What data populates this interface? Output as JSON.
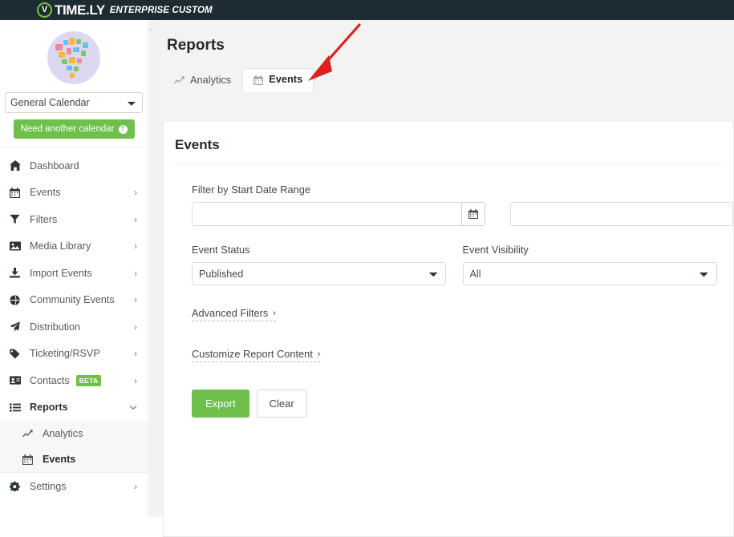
{
  "brand": {
    "mark": "timely-v-logo",
    "name": "TIME.LY",
    "edition": "ENTERPRISE CUSTOM",
    "accent_color": "#7ac143",
    "bar_color": "#1d2b33"
  },
  "sidebar": {
    "calendar_select": {
      "value": "General Calendar",
      "options": [
        "General Calendar"
      ]
    },
    "need_calendar_button": "Need another calendar",
    "need_calendar_help_icon": "question-circle-icon",
    "collapse_icon": "chevron-left-icon",
    "items": [
      {
        "label": "Dashboard",
        "icon": "home-icon",
        "chevron": "",
        "active": false
      },
      {
        "label": "Events",
        "icon": "calendar-icon",
        "chevron": "›",
        "active": false
      },
      {
        "label": "Filters",
        "icon": "funnel-icon",
        "chevron": "›",
        "active": false
      },
      {
        "label": "Media Library",
        "icon": "image-icon",
        "chevron": "›",
        "active": false
      },
      {
        "label": "Import Events",
        "icon": "download-icon",
        "chevron": "›",
        "active": false
      },
      {
        "label": "Community Events",
        "icon": "globe-icon",
        "chevron": "›",
        "active": false
      },
      {
        "label": "Distribution",
        "icon": "paper-plane-icon",
        "chevron": "›",
        "active": false
      },
      {
        "label": "Ticketing/RSVP",
        "icon": "tag-icon",
        "chevron": "›",
        "active": false
      },
      {
        "label": "Contacts",
        "icon": "address-card-icon",
        "chevron": "›",
        "badge": "BETA",
        "active": false
      },
      {
        "label": "Reports",
        "icon": "list-icon",
        "chevron": "⌄",
        "active": true
      }
    ],
    "sub_items": [
      {
        "label": "Analytics",
        "icon": "chart-line-icon",
        "current": false
      },
      {
        "label": "Events",
        "icon": "calendar-icon",
        "current": true
      }
    ],
    "footer_items": [
      {
        "label": "Settings",
        "icon": "gear-icon",
        "chevron": "›"
      }
    ]
  },
  "main": {
    "page_title": "Reports",
    "tabs": [
      {
        "label": "Analytics",
        "icon": "chart-line-icon",
        "active": false
      },
      {
        "label": "Events",
        "icon": "calendar-icon",
        "active": true
      }
    ],
    "card_title": "Events",
    "form": {
      "date_range_label": "Filter by Start Date Range",
      "date_from": {
        "value": "",
        "placeholder": ""
      },
      "date_to": {
        "value": "",
        "placeholder": ""
      },
      "calendar_button_icon": "calendar-icon",
      "event_status_label": "Event Status",
      "event_status": {
        "value": "Published",
        "options": [
          "Published"
        ]
      },
      "event_visibility_label": "Event Visibility",
      "event_visibility": {
        "value": "All",
        "options": [
          "All"
        ]
      },
      "advanced_filters": "Advanced Filters",
      "advanced_filters_chevron": "›",
      "customize_report": "Customize Report Content",
      "customize_report_chevron": "›",
      "export_button": "Export",
      "clear_button": "Clear"
    }
  },
  "annotation": {
    "type": "arrow",
    "color": "#e01f1f",
    "points_to": "events-tab"
  },
  "colors": {
    "green": "#6fbf4b",
    "dark": "#1d2b33",
    "page_bg": "#f3f3f2"
  }
}
